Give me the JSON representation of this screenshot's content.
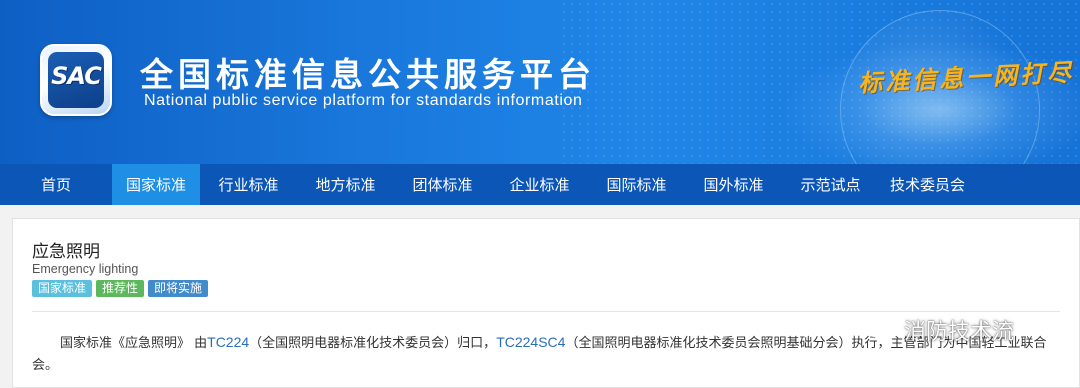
{
  "header": {
    "logo_text": "SAC",
    "title": "全国标准信息公共服务平台",
    "subtitle": "National public service platform  for standards information",
    "slogan": "标准信息一网打尽"
  },
  "nav": {
    "items": [
      {
        "label": "首页"
      },
      {
        "label": "国家标准"
      },
      {
        "label": "行业标准"
      },
      {
        "label": "地方标准"
      },
      {
        "label": "团体标准"
      },
      {
        "label": "企业标准"
      },
      {
        "label": "国际标准"
      },
      {
        "label": "国外标准"
      },
      {
        "label": "示范试点"
      },
      {
        "label": "技术委员会"
      }
    ],
    "active_index": 1
  },
  "standard": {
    "title_cn": "应急照明",
    "title_en": "Emergency lighting",
    "badges": [
      "国家标准",
      "推荐性",
      "即将实施"
    ],
    "description": {
      "part1": "国家标准《应急照明》 由",
      "tc": "TC224",
      "part2": "（全国照明电器标准化技术委员会）归口，",
      "sc": "TC224SC4",
      "part3": "（全国照明电器标准化技术委员会照明基础分会）执行，主管部门为中国轻工业联合",
      "part4": "会。"
    }
  },
  "watermark": {
    "text": "消防技术流"
  },
  "colors": {
    "nav_bg": "#0b56b7",
    "nav_active": "#1f8fe6",
    "badge_national": "#5bc0de",
    "badge_recommended": "#5cb85c",
    "badge_upcoming": "#428bca",
    "link": "#2a6ebb"
  }
}
